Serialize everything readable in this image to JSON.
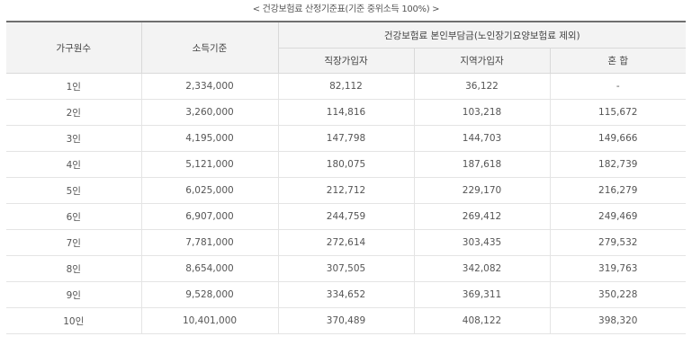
{
  "caption": "< 건강보험료 산정기준표(기준 중위소득 100%) >",
  "headers": {
    "household": "가구원수",
    "income": "소득기준",
    "premium_group": "건강보험료 본인부담금(노인장기요양보험료 제외)",
    "employee": "직장가입자",
    "regional": "지역가입자",
    "mixed": "혼 합"
  },
  "rows": [
    {
      "household": "1인",
      "income": "2,334,000",
      "employee": "82,112",
      "regional": "36,122",
      "mixed": "-"
    },
    {
      "household": "2인",
      "income": "3,260,000",
      "employee": "114,816",
      "regional": "103,218",
      "mixed": "115,672"
    },
    {
      "household": "3인",
      "income": "4,195,000",
      "employee": "147,798",
      "regional": "144,703",
      "mixed": "149,666"
    },
    {
      "household": "4인",
      "income": "5,121,000",
      "employee": "180,075",
      "regional": "187,618",
      "mixed": "182,739"
    },
    {
      "household": "5인",
      "income": "6,025,000",
      "employee": "212,712",
      "regional": "229,170",
      "mixed": "216,279"
    },
    {
      "household": "6인",
      "income": "6,907,000",
      "employee": "244,759",
      "regional": "269,412",
      "mixed": "249,469"
    },
    {
      "household": "7인",
      "income": "7,781,000",
      "employee": "272,614",
      "regional": "303,435",
      "mixed": "279,532"
    },
    {
      "household": "8인",
      "income": "8,654,000",
      "employee": "307,505",
      "regional": "342,082",
      "mixed": "319,763"
    },
    {
      "household": "9인",
      "income": "9,528,000",
      "employee": "334,652",
      "regional": "369,311",
      "mixed": "350,228"
    },
    {
      "household": "10인",
      "income": "10,401,000",
      "employee": "370,489",
      "regional": "408,122",
      "mixed": "398,320"
    }
  ]
}
